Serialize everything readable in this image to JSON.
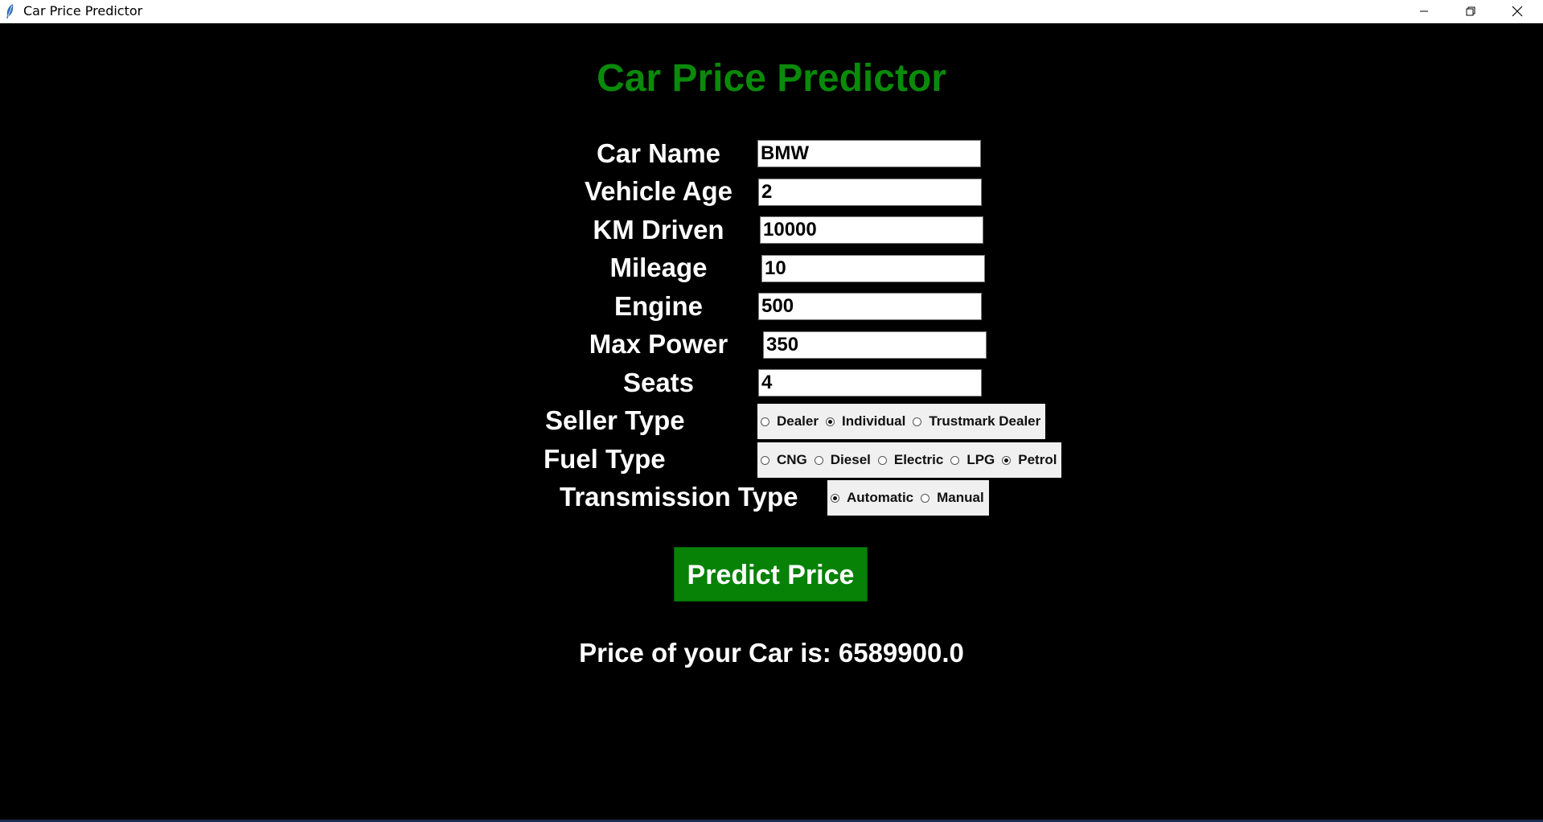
{
  "window": {
    "title": "Car Price Predictor",
    "controls": [
      "minimize-icon",
      "restore-icon",
      "close-icon"
    ]
  },
  "app": {
    "heading": "Car Price Predictor",
    "heading_color": "#0a8a0a",
    "fields": [
      {
        "label": "Car Name",
        "value": "BMW"
      },
      {
        "label": "Vehicle Age",
        "value": "2"
      },
      {
        "label": "KM Driven",
        "value": "10000"
      },
      {
        "label": "Mileage",
        "value": "10"
      },
      {
        "label": "Engine",
        "value": "500"
      },
      {
        "label": "Max Power",
        "value": "350"
      },
      {
        "label": "Seats",
        "value": "4"
      }
    ],
    "seller_type": {
      "label": "Seller Type",
      "options": [
        "Dealer",
        "Individual",
        "Trustmark Dealer"
      ],
      "selected": "Individual"
    },
    "fuel_type": {
      "label": "Fuel Type",
      "options": [
        "CNG",
        "Diesel",
        "Electric",
        "LPG",
        "Petrol"
      ],
      "selected": "Petrol"
    },
    "transmission_type": {
      "label": "Transmission Type",
      "options": [
        "Automatic",
        "Manual"
      ],
      "selected": "Automatic"
    },
    "predict_button": "Predict Price",
    "button_color": "#078207",
    "result_text": "Price of your Car is: 6589900.0"
  }
}
